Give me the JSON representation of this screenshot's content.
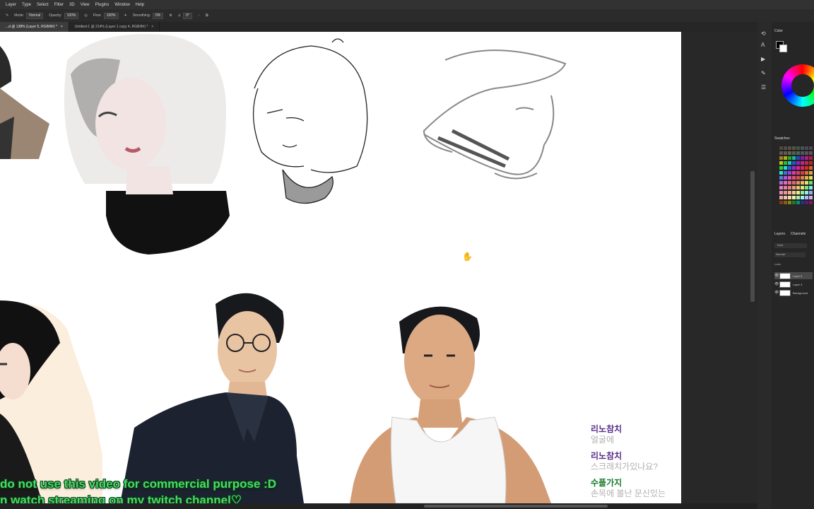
{
  "menu": [
    "Layer",
    "Type",
    "Select",
    "Filter",
    "3D",
    "View",
    "Plugins",
    "Window",
    "Help"
  ],
  "options": {
    "mode_label": "Mode:",
    "mode_value": "Normal",
    "opacity_label": "Opacity:",
    "opacity_value": "100%",
    "flow_label": "Flow:",
    "flow_value": "100%",
    "smoothing_label": "Smoothing:",
    "smoothing_value": "0%",
    "angle_value": "0°"
  },
  "tabs": [
    "...d @ 138% (Layer 5, RGB/8#) *",
    "Untitled-1 @ 214% (Layer 1 copy 4, RGB/8#) *"
  ],
  "panels": {
    "color_title": "Color",
    "swatches_title": "Swatches",
    "layers_title": "Layers",
    "channels_title": "Channels",
    "kind_label": "Kind",
    "blend_value": "Normal",
    "lock_label": "Lock:",
    "layers": [
      "Layer 5",
      "Layer 4",
      "Background"
    ]
  },
  "overlay": {
    "line1": "do not use this video for commercial purpose :D",
    "line2": "n watch streaming on my twitch channel♡"
  },
  "chat": [
    {
      "user": "리노참치",
      "msg": "얼굴에"
    },
    {
      "user": "리노참치",
      "msg": "스크래치가있나요?"
    },
    {
      "user": "수플가지",
      "msg": "손목에 볼난 문신있는"
    }
  ],
  "colors": {
    "accent_green": "#4cd964",
    "chat_purple": "#5a2f8a",
    "chat_green": "#1a7a2a"
  }
}
